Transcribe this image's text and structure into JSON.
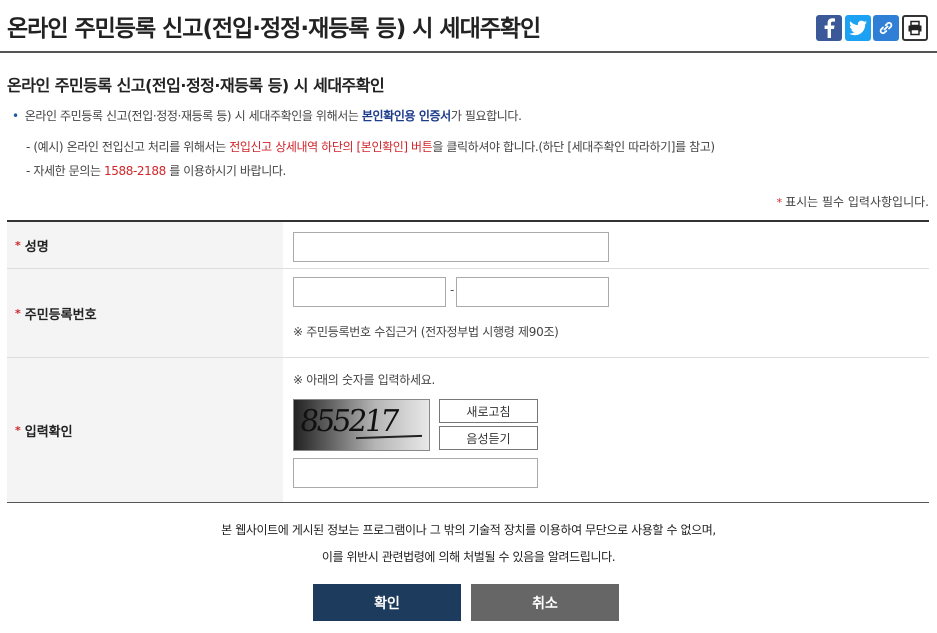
{
  "header": {
    "title": "온라인 주민등록 신고(전입·정정·재등록 등) 시 세대주확인",
    "share": {
      "facebook_icon": "f",
      "twitter_icon": "twitter-bird",
      "link_icon": "link",
      "print_icon": "printer"
    }
  },
  "section": {
    "title": "온라인 주민등록 신고(전입·정정·재등록 등) 시 세대주확인"
  },
  "notice": {
    "line1": {
      "prefix": "온라인 주민등록 신고(전입·정정·재등록 등) 시 세대주확인을 위해서는 ",
      "emphasis": "본인확인용 인증서",
      "suffix": "가 필요합니다."
    },
    "line2": {
      "prefix": "- (예시) 온라인 전입신고 처리를 위해서는 ",
      "emphasis": "전입신고 상세내역 하단의 [본인확인] 버튼",
      "suffix": "을 클릭하셔야 합니다.(하단 [세대주확인 따라하기]를 참고)"
    },
    "line3": {
      "prefix": "- 자세한 문의는 ",
      "phone": "1588-2188",
      "suffix": " 를 이용하시기 바랍니다."
    }
  },
  "required_note": "표시는 필수 입력사항입니다.",
  "required_mark": "*",
  "form": {
    "name": {
      "label": "성명",
      "value": ""
    },
    "rrn": {
      "label": "주민등록번호",
      "value_front": "",
      "separator": "-",
      "value_back": "",
      "hint": "※ 주민등록번호 수집근거 (전자정부법 시행령 제90조)"
    },
    "captcha": {
      "label": "입력확인",
      "hint": "※ 아래의 숫자를 입력하세요.",
      "image_text": "855217",
      "refresh_label": "새로고침",
      "audio_label": "음성듣기",
      "value": ""
    }
  },
  "disclaimer": {
    "line1": "본 웹사이트에 게시된 정보는 프로그램이나 그 밖의 기술적 장치를 이용하여 무단으로 사용할 수 없으며,",
    "line2": "이를 위반시 관련법령에 의해 처벌될 수 있음을 알려드립니다."
  },
  "buttons": {
    "confirm": "확인",
    "cancel": "취소"
  },
  "colors": {
    "accent_red": "#d0262b",
    "accent_blue": "#1d3c8a",
    "confirm_bg": "#1d3b5c",
    "cancel_bg": "#666666"
  }
}
